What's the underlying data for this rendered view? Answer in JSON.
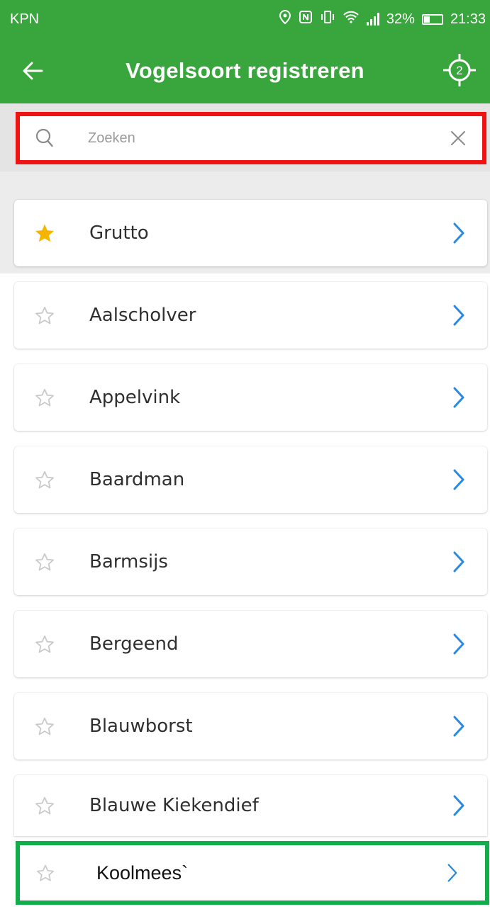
{
  "status_bar": {
    "carrier": "KPN",
    "battery_percent": "32%",
    "time": "21:33"
  },
  "app_bar": {
    "title": "Vogelsoort registreren",
    "location_badge": "2"
  },
  "search": {
    "placeholder": "Zoeken"
  },
  "favorites": [
    {
      "label": "Grutto",
      "starred": true
    }
  ],
  "birds": [
    {
      "label": "Aalscholver",
      "starred": false
    },
    {
      "label": "Appelvink",
      "starred": false
    },
    {
      "label": "Baardman",
      "starred": false
    },
    {
      "label": "Barmsijs",
      "starred": false
    },
    {
      "label": "Bergeend",
      "starred": false
    },
    {
      "label": "Blauwborst",
      "starred": false
    },
    {
      "label": "Blauwe Kiekendief",
      "starred": false
    }
  ],
  "highlighted_item": {
    "label": "Koolmees`",
    "starred": false
  },
  "colors": {
    "app_green": "#39a53d",
    "star_filled": "#f5b400",
    "chevron_blue": "#2a8ae0",
    "search_outline": "#ee1414",
    "highlight_outline": "#12ad4a"
  }
}
